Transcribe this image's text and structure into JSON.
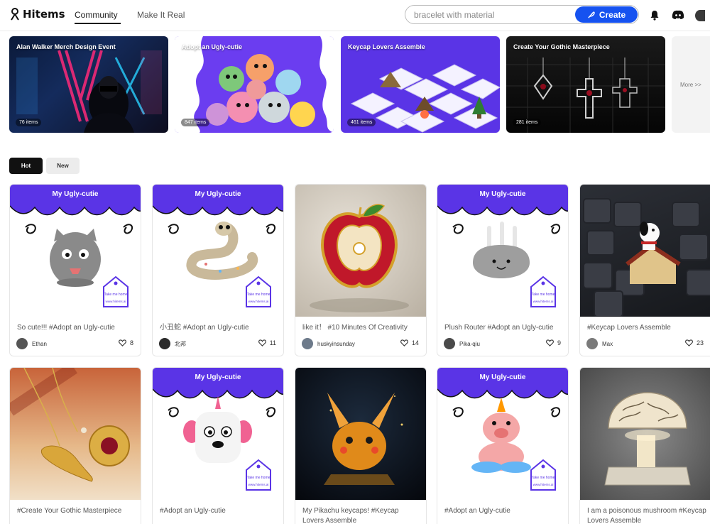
{
  "header": {
    "logo": "Hitems",
    "nav": [
      "Community",
      "Make It Real"
    ],
    "search_value": "bracelet with material",
    "create_label": "Create"
  },
  "banners": [
    {
      "title": "Alan Walker Merch Design Event",
      "count": "76 items"
    },
    {
      "title": "Adopt an Ugly-cutie",
      "count": "847 items"
    },
    {
      "title": "Keycap Lovers Assemble",
      "count": "461 items"
    },
    {
      "title": "Create Your Gothic Masterpiece",
      "count": "281 items"
    }
  ],
  "banner_more": "More >>",
  "filters": [
    "Hot",
    "New"
  ],
  "uc_title": "My Ugly-cutie",
  "uc_tag": [
    "Take me home",
    "www.hitems.ai"
  ],
  "cards": [
    {
      "caption": "So cute!!! #Adopt an Ugly-cutie",
      "user": "Ethan",
      "likes": "8"
    },
    {
      "caption": "小丑蛇 #Adopt an Ugly-cutie",
      "user": "北邦",
      "likes": "11"
    },
    {
      "caption": "like it！ #10 Minutes Of Creativity",
      "user": "huskyinsunday",
      "likes": "14"
    },
    {
      "caption": "Plush Router #Adopt an Ugly-cutie",
      "user": "Pika-qiu",
      "likes": "9"
    },
    {
      "caption": "#Keycap Lovers Assemble",
      "user": "Max",
      "likes": "23"
    },
    {
      "caption": "#Create Your Gothic Masterpiece"
    },
    {
      "caption": "#Adopt an Ugly-cutie"
    },
    {
      "caption": "My Pikachu keycaps! #Keycap Lovers Assemble"
    },
    {
      "caption": "#Adopt an Ugly-cutie"
    },
    {
      "caption": "I am a poisonous mushroom #Keycap Lovers Assemble"
    }
  ],
  "colors": {
    "brand": "#1652f0",
    "ugly_cutie_purple": "#5a34e6"
  }
}
